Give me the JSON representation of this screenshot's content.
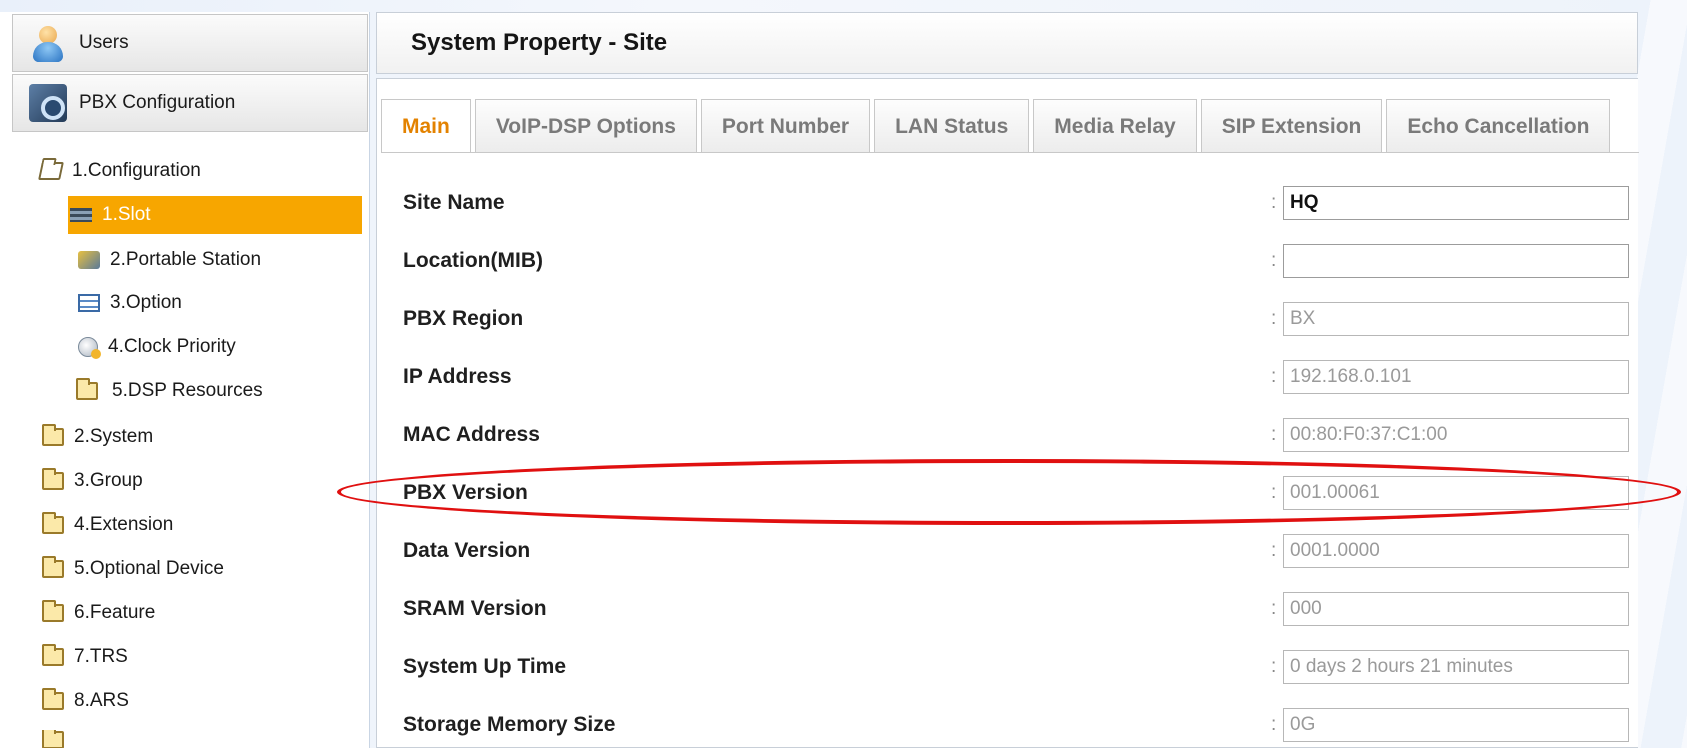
{
  "sidebar": {
    "users_label": "Users",
    "pbx_label": "PBX Configuration",
    "tree": [
      {
        "label": "1.Configuration",
        "icon": "folder-open-icon"
      },
      {
        "label": "1.Slot",
        "icon": "slot-icon",
        "selected": true
      },
      {
        "label": "2.Portable Station",
        "icon": "portable-station-icon"
      },
      {
        "label": "3.Option",
        "icon": "option-icon"
      },
      {
        "label": "4.Clock Priority",
        "icon": "clock-priority-icon"
      },
      {
        "label": "5.DSP Resources",
        "icon": "folder-icon"
      },
      {
        "label": "2.System",
        "icon": "folder-icon"
      },
      {
        "label": "3.Group",
        "icon": "folder-icon"
      },
      {
        "label": "4.Extension",
        "icon": "folder-icon"
      },
      {
        "label": "5.Optional Device",
        "icon": "folder-icon"
      },
      {
        "label": "6.Feature",
        "icon": "folder-icon"
      },
      {
        "label": "7.TRS",
        "icon": "folder-icon"
      },
      {
        "label": "8.ARS",
        "icon": "folder-icon"
      }
    ]
  },
  "main": {
    "title": "System Property - Site",
    "tabs": [
      {
        "label": "Main",
        "active": true
      },
      {
        "label": "VoIP-DSP Options"
      },
      {
        "label": "Port Number"
      },
      {
        "label": "LAN Status"
      },
      {
        "label": "Media Relay"
      },
      {
        "label": "SIP Extension"
      },
      {
        "label": "Echo Cancellation"
      }
    ],
    "colon": ":",
    "fields": [
      {
        "label": "Site Name",
        "value": "HQ",
        "editable": true
      },
      {
        "label": "Location(MIB)",
        "value": "",
        "editable": true
      },
      {
        "label": "PBX Region",
        "value": "BX"
      },
      {
        "label": "IP Address",
        "value": "192.168.0.101"
      },
      {
        "label": "MAC Address",
        "value": "00:80:F0:37:C1:00"
      },
      {
        "label": "PBX Version",
        "value": "001.00061"
      },
      {
        "label": "Data Version",
        "value": "0001.0000"
      },
      {
        "label": "SRAM Version",
        "value": "000"
      },
      {
        "label": "System Up Time",
        "value": "0 days 2 hours 21 minutes"
      },
      {
        "label": "Storage Memory Size",
        "value": "0G"
      }
    ]
  },
  "colors": {
    "selected_bg": "#f7a600",
    "active_tab_text": "#e38200",
    "highlight_ring": "#e01010"
  }
}
